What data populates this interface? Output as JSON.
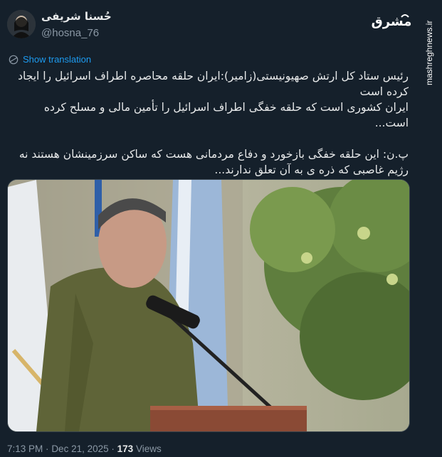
{
  "author": {
    "display_name": "حُسنا شریفی",
    "handle": "@hosna_76"
  },
  "watermark": {
    "logo_text": "مشرق",
    "site": "mashreghnews.ir"
  },
  "translate_label": "Show translation",
  "tweet_lines": [
    "رئیس ستاد کل ارتش صهیونیستی(زامیر):ایران حلقه محاصره اطراف اسرائیل را ایجاد کرده است",
    "ایران کشوری است که حلقه خفگی اطراف اسرائیل را تأمین مالی و مسلح کرده است...",
    "",
    "پ.ن: این حلقه خفگی  بازخورد  و دفاع مردمانی هست که ساکن سرزمینشان هستند نه رژیم غاصبی که ذره ی به آن تعلق ندارند..."
  ],
  "footer": {
    "time": "7:13 PM",
    "separator": "·",
    "date": "Dec 21, 2025",
    "views_count": "173",
    "views_label": "Views"
  },
  "colors": {
    "background": "#15202b",
    "link": "#1d9bf0",
    "muted": "#8b98a5"
  }
}
